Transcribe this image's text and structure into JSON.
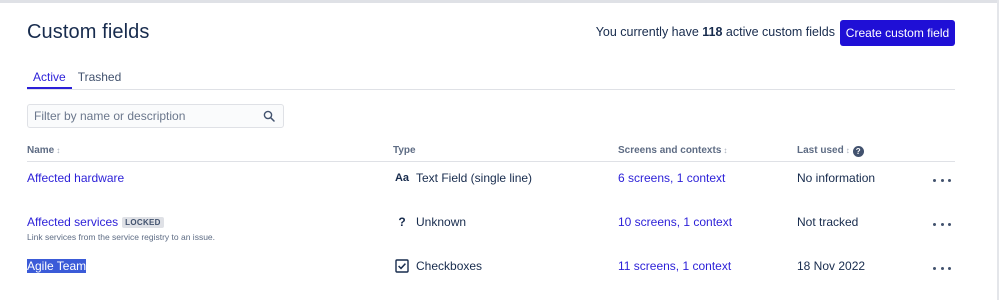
{
  "header": {
    "title": "Custom fields",
    "count_prefix": "You currently have",
    "count_value": "118",
    "count_suffix": "active custom fields",
    "create_label": "Create custom field",
    "accent_color": "#1f0fd6"
  },
  "tabs": [
    {
      "label": "Active",
      "active": true
    },
    {
      "label": "Trashed",
      "active": false
    }
  ],
  "search": {
    "placeholder": "Filter by name or description",
    "value": ""
  },
  "table": {
    "columns": {
      "name": "Name",
      "type": "Type",
      "screens": "Screens and contexts",
      "last_used": "Last used"
    },
    "rows": [
      {
        "name": "Affected hardware",
        "locked_label": "",
        "description": "",
        "type_icon": "text-field-icon",
        "type_glyph": "Aa",
        "type": "Text Field (single line)",
        "screens": "6 screens, 1 context",
        "last_used": "No information"
      },
      {
        "name": "Affected services",
        "locked_label": "LOCKED",
        "description": "Link services from the service registry to an issue.",
        "type_icon": "unknown-icon",
        "type_glyph": "?",
        "type": "Unknown",
        "screens": "10 screens, 1 context",
        "last_used": "Not tracked"
      },
      {
        "name": "Agile Team",
        "locked_label": "",
        "description": "",
        "type_icon": "checkbox-icon",
        "type_glyph": "",
        "type": "Checkboxes",
        "screens": "11 screens, 1 context",
        "last_used": "18 Nov 2022"
      }
    ]
  }
}
